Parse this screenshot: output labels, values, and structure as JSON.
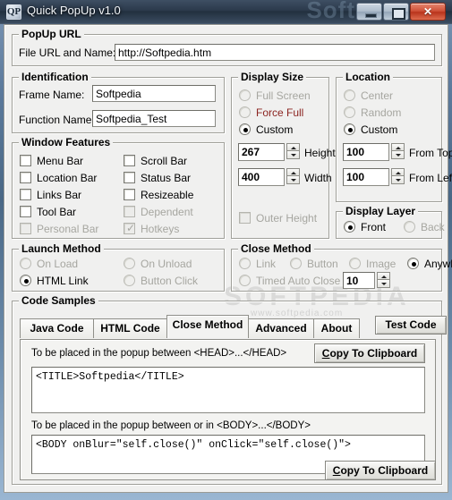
{
  "window": {
    "title": "Quick PopUp v1.0",
    "icon": "QP",
    "titlebar_watermark": "Soft",
    "buttons": {
      "minimize": "minimize-icon",
      "maximize": "maximize-icon",
      "close": "✕"
    }
  },
  "watermark": {
    "main": "SOFTPEDIA",
    "sub": "www.softpedia.com"
  },
  "popup_url": {
    "caption": "PopUp URL",
    "field_label": "File URL and Name:",
    "value": "http://Softpedia.htm",
    "placeholder": ""
  },
  "identification": {
    "caption": "Identification",
    "frame_label": "Frame Name:",
    "frame_value": "Softpedia",
    "function_label": "Function Name:",
    "function_value": "Softpedia_Test"
  },
  "window_features": {
    "caption": "Window Features",
    "items": [
      {
        "label": "Menu Bar",
        "checked": false,
        "disabled": false
      },
      {
        "label": "Location Bar",
        "checked": false,
        "disabled": false
      },
      {
        "label": "Links Bar",
        "checked": false,
        "disabled": false
      },
      {
        "label": "Tool Bar",
        "checked": false,
        "disabled": false
      },
      {
        "label": "Personal Bar",
        "checked": false,
        "disabled": true
      },
      {
        "label": "Scroll Bar",
        "checked": false,
        "disabled": false
      },
      {
        "label": "Status Bar",
        "checked": false,
        "disabled": false
      },
      {
        "label": "Resizeable",
        "checked": false,
        "disabled": false
      },
      {
        "label": "Dependent",
        "checked": false,
        "disabled": true
      },
      {
        "label": "Hotkeys",
        "checked": true,
        "disabled": true
      }
    ]
  },
  "display_size": {
    "caption": "Display Size",
    "options": [
      {
        "label": "Full Screen",
        "selected": false,
        "disabled": true,
        "color": "#000000"
      },
      {
        "label": "Force Full",
        "selected": false,
        "disabled": true,
        "color": "#8b2420"
      },
      {
        "label": "Custom",
        "selected": true,
        "disabled": false,
        "color": "#000000"
      }
    ],
    "height_value": "267",
    "height_label": "Height",
    "width_value": "400",
    "width_label": "Width",
    "outer_height_label": "Outer Height",
    "outer_height_checked": false,
    "outer_height_disabled": true
  },
  "location": {
    "caption": "Location",
    "options": [
      {
        "label": "Center",
        "selected": false,
        "disabled": true
      },
      {
        "label": "Random",
        "selected": false,
        "disabled": true
      },
      {
        "label": "Custom",
        "selected": true,
        "disabled": false
      }
    ],
    "from_top_value": "100",
    "from_top_label": "From Top",
    "from_left_value": "100",
    "from_left_label": "From Left"
  },
  "display_layer": {
    "caption": "Display Layer",
    "options": [
      {
        "label": "Front",
        "selected": true,
        "disabled": false
      },
      {
        "label": "Back",
        "selected": false,
        "disabled": true
      }
    ]
  },
  "launch_method": {
    "caption": "Launch Method",
    "options": [
      {
        "label": "On Load",
        "selected": false,
        "disabled": true
      },
      {
        "label": "HTML Link",
        "selected": true,
        "disabled": false
      },
      {
        "label": "On Unload",
        "selected": false,
        "disabled": true
      },
      {
        "label": "Button Click",
        "selected": false,
        "disabled": true
      }
    ]
  },
  "close_method": {
    "caption": "Close Method",
    "options": [
      {
        "label": "Link",
        "selected": false,
        "disabled": true
      },
      {
        "label": "Button",
        "selected": false,
        "disabled": true
      },
      {
        "label": "Image",
        "selected": false,
        "disabled": true
      },
      {
        "label": "Anywhere",
        "selected": true,
        "disabled": false
      }
    ],
    "timed_label": "Timed Auto Close",
    "timed_selected": false,
    "timed_disabled": true,
    "timed_value": "10"
  },
  "code_samples": {
    "caption": "Code Samples",
    "tabs": [
      {
        "label": "Java Code",
        "active": false
      },
      {
        "label": "HTML Code",
        "active": false
      },
      {
        "label": "Close Method",
        "active": true
      },
      {
        "label": "Advanced",
        "active": false
      },
      {
        "label": "About",
        "active": false
      }
    ],
    "test_code_button": "Test Code",
    "head_note": "To be placed in the popup between <HEAD>...</HEAD>",
    "head_code": "<TITLE>Softpedia</TITLE>",
    "copy_button_top_prefix": "C",
    "copy_button_top_rest": "opy To Clipboard",
    "body_note": "To be placed in the popup between or in <BODY>...</BODY>",
    "body_code": "<BODY onBlur=\"self.close()\" onClick=\"self.close()\">",
    "copy_button_bottom_prefix": "C",
    "copy_button_bottom_rest": "opy To Clipboard"
  }
}
